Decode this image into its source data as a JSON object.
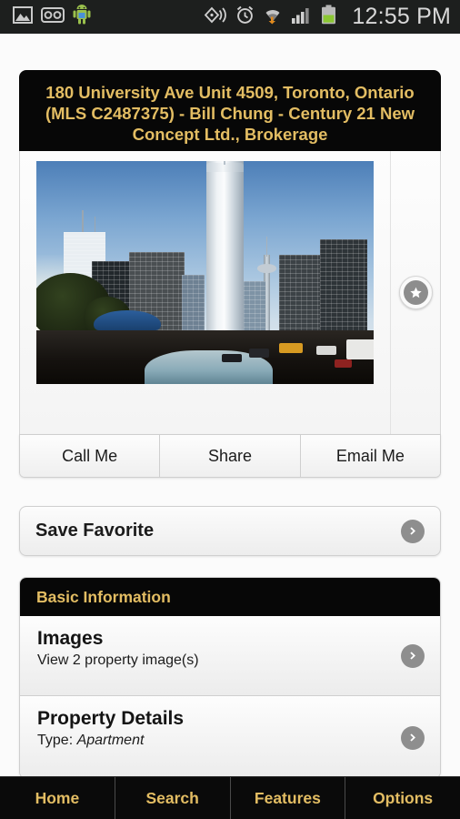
{
  "status_bar": {
    "time": "12:55 PM",
    "left_icons": [
      "gallery-icon",
      "voicemail-icon",
      "android-robot-icon"
    ],
    "right_icons": [
      "nfc-beam-icon",
      "alarm-clock-icon",
      "wifi-download-icon",
      "cellular-signal-icon",
      "battery-icon"
    ],
    "background_color": "#1d1f1e",
    "text_color": "#d8d8d8"
  },
  "listing": {
    "title": "180 University Ave Unit 4509, Toronto, Ontario (MLS C2487375) - Bill Chung - Century 21 New Concept Ltd., Brokerage",
    "accent_color": "#e3bd63",
    "header_background": "#070707"
  },
  "photo": {
    "alt": "Toronto downtown skyline with tall condo tower",
    "favorite_icon": "star-icon"
  },
  "actions": {
    "call": "Call Me",
    "share": "Share",
    "email": "Email Me"
  },
  "favorite": {
    "label": "Save Favorite",
    "arrow_icon": "chevron-right-icon"
  },
  "basic_information": {
    "header": "Basic Information",
    "rows": [
      {
        "title": "Images",
        "subtitle": "View 2 property image(s)",
        "arrow_icon": "chevron-right-icon"
      },
      {
        "title": "Property Details",
        "subtitle_label": "Type:",
        "subtitle_value": "Apartment",
        "arrow_icon": "chevron-right-icon"
      }
    ]
  },
  "bottom_nav": {
    "items": [
      {
        "label": "Home"
      },
      {
        "label": "Search"
      },
      {
        "label": "Features"
      },
      {
        "label": "Options"
      }
    ],
    "background_color": "#0a0a0a",
    "text_color": "#e3bd63"
  }
}
